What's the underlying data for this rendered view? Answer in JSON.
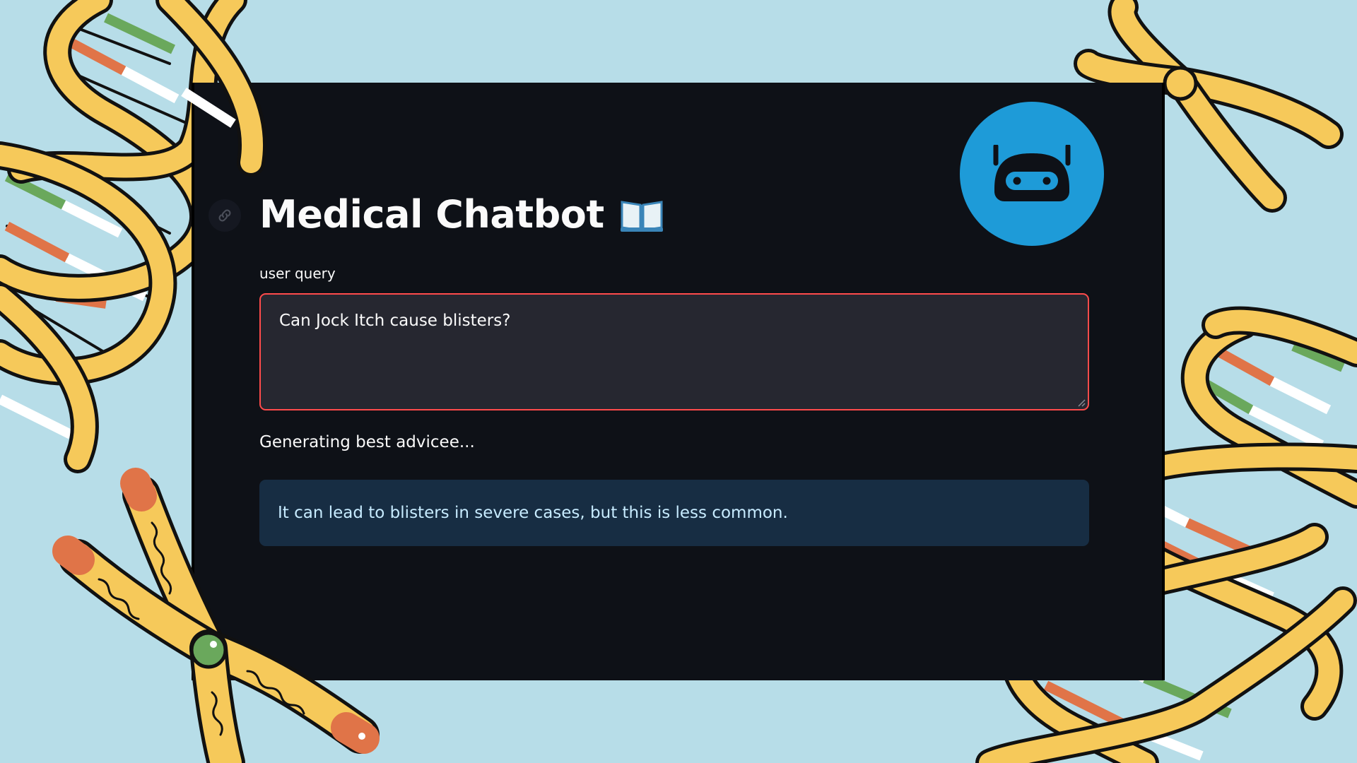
{
  "app": {
    "title": "Medical Chatbot",
    "title_icon": "open-book-icon",
    "avatar_icon": "robot-icon"
  },
  "form": {
    "label": "user query",
    "value": "Can Jock Itch cause blisters?"
  },
  "status": "Generating best advicee...",
  "response": "It can lead to blisters in severe cases, but this is less common.",
  "colors": {
    "background": "#b7dde8",
    "app_background": "#0e1117",
    "input_background": "#262730",
    "input_border": "#ff4b4b",
    "response_background": "#172d43",
    "response_text": "#c7ebff",
    "avatar_blue": "#1e9bd8",
    "dna_yellow": "#f6c95a",
    "dna_green": "#6aa85c",
    "dna_orange": "#e07448"
  }
}
